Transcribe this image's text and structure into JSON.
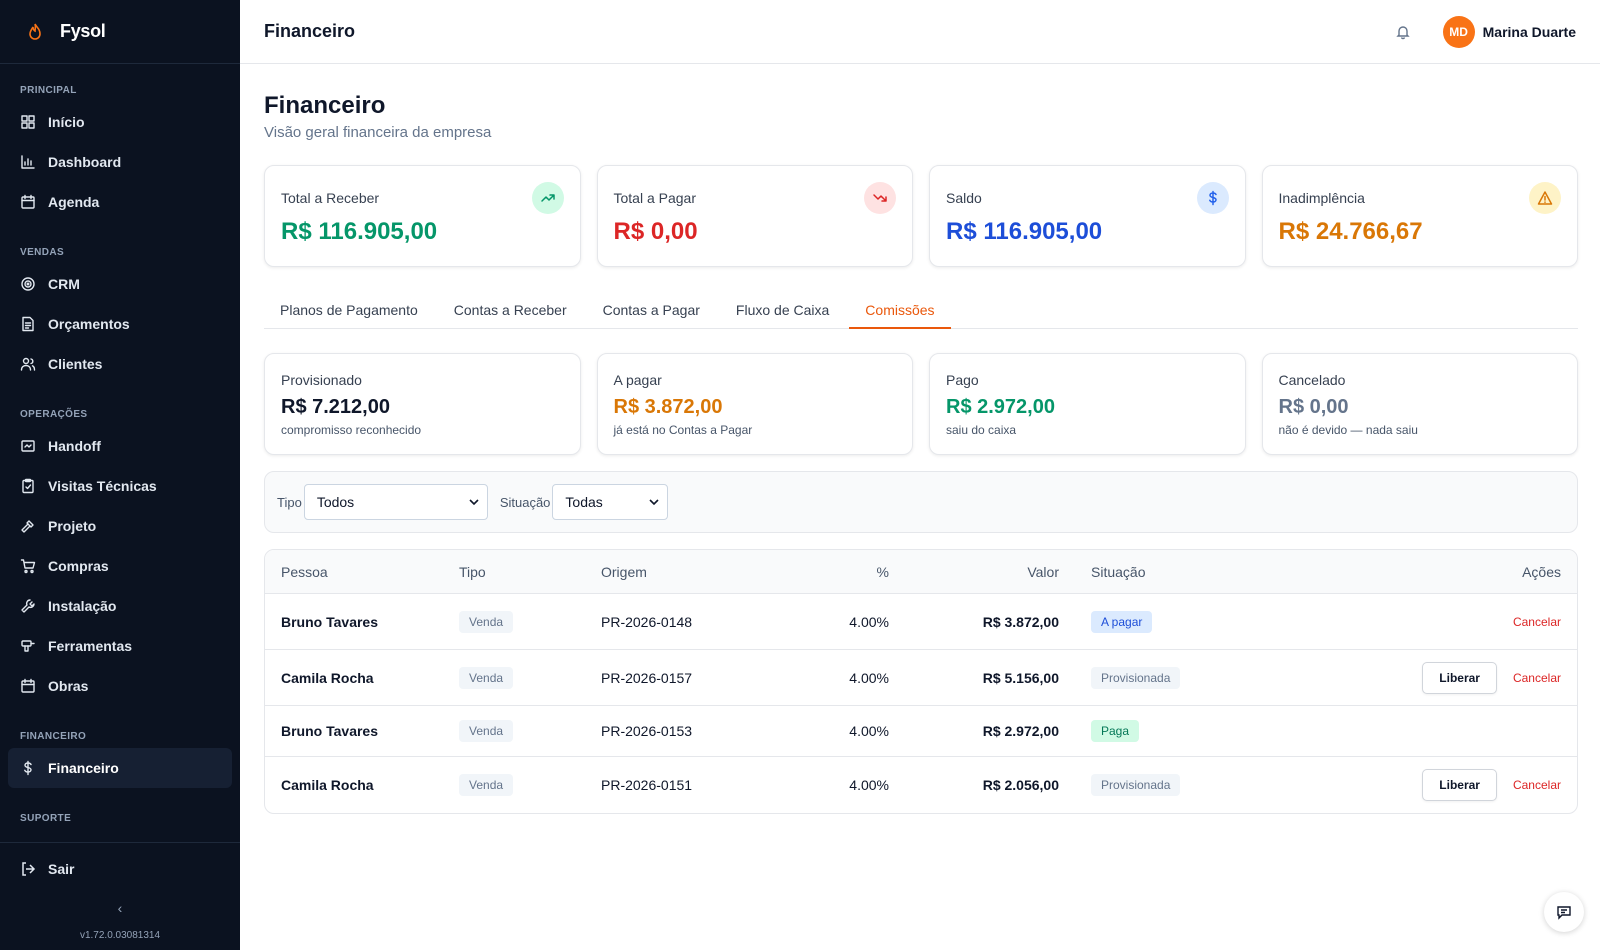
{
  "brand": {
    "name": "Fysol",
    "accent": "#f97316"
  },
  "sidebar": {
    "sections": [
      {
        "label": "PRINCIPAL",
        "items": [
          {
            "label": "Início",
            "icon": "grid-icon"
          },
          {
            "label": "Dashboard",
            "icon": "bar-chart-icon"
          },
          {
            "label": "Agenda",
            "icon": "calendar-icon"
          }
        ]
      },
      {
        "label": "VENDAS",
        "items": [
          {
            "label": "CRM",
            "icon": "target-icon"
          },
          {
            "label": "Orçamentos",
            "icon": "file-text-icon"
          },
          {
            "label": "Clientes",
            "icon": "users-icon"
          }
        ]
      },
      {
        "label": "OPERAÇÕES",
        "items": [
          {
            "label": "Handoff",
            "icon": "handoff-icon"
          },
          {
            "label": "Visitas Técnicas",
            "icon": "clipboard-icon"
          },
          {
            "label": "Projeto",
            "icon": "hammer-icon"
          },
          {
            "label": "Compras",
            "icon": "cart-icon"
          },
          {
            "label": "Instalação",
            "icon": "wrench-icon"
          },
          {
            "label": "Ferramentas",
            "icon": "drill-icon"
          },
          {
            "label": "Obras",
            "icon": "calendar-icon"
          }
        ]
      },
      {
        "label": "FINANCEIRO",
        "items": [
          {
            "label": "Financeiro",
            "icon": "dollar-icon",
            "active": true
          }
        ]
      },
      {
        "label": "SUPORTE",
        "items": []
      }
    ],
    "logout": "Sair",
    "collapse": "‹",
    "version": "v1.72.0.03081314"
  },
  "topbar": {
    "title": "Financeiro",
    "user": {
      "initials": "MD",
      "name": "Marina Duarte"
    }
  },
  "page": {
    "title": "Financeiro",
    "subtitle": "Visão geral financeira da empresa"
  },
  "summary": [
    {
      "label": "Total a Receber",
      "value": "R$ 116.905,00",
      "color": "#059669",
      "icon": "trending-up-icon",
      "icon_bg": "#d1fae5",
      "icon_color": "#059669"
    },
    {
      "label": "Total a Pagar",
      "value": "R$ 0,00",
      "color": "#dc2626",
      "icon": "trending-down-icon",
      "icon_bg": "#fee2e2",
      "icon_color": "#dc2626"
    },
    {
      "label": "Saldo",
      "value": "R$ 116.905,00",
      "color": "#1d4ed8",
      "icon": "dollar-icon",
      "icon_bg": "#dbeafe",
      "icon_color": "#2563eb"
    },
    {
      "label": "Inadimplência",
      "value": "R$ 24.766,67",
      "color": "#d97706",
      "icon": "alert-triangle-icon",
      "icon_bg": "#fef3c7",
      "icon_color": "#d97706"
    }
  ],
  "tabs": [
    {
      "label": "Planos de Pagamento"
    },
    {
      "label": "Contas a Receber"
    },
    {
      "label": "Contas a Pagar"
    },
    {
      "label": "Fluxo de Caixa"
    },
    {
      "label": "Comissões",
      "active": true
    }
  ],
  "commission_summary": [
    {
      "label": "Provisionado",
      "value": "R$ 7.212,00",
      "note": "compromisso reconhecido",
      "color": "#0f172a"
    },
    {
      "label": "A pagar",
      "value": "R$ 3.872,00",
      "note": "já está no Contas a Pagar",
      "color": "#d97706"
    },
    {
      "label": "Pago",
      "value": "R$ 2.972,00",
      "note": "saiu do caixa",
      "color": "#059669"
    },
    {
      "label": "Cancelado",
      "value": "R$ 0,00",
      "note": "não é devido — nada saiu",
      "color": "#64748b"
    }
  ],
  "filters": {
    "tipo": {
      "label": "Tipo",
      "value": "Todos"
    },
    "situacao": {
      "label": "Situação",
      "value": "Todas"
    }
  },
  "table": {
    "headers": [
      "Pessoa",
      "Tipo",
      "Origem",
      "%",
      "Valor",
      "Situação",
      "Ações"
    ],
    "rows": [
      {
        "pessoa": "Bruno Tavares",
        "tipo": "Venda",
        "origem": "PR-2026-0148",
        "pct": "4.00%",
        "valor": "R$ 3.872,00",
        "situacao": "A pagar",
        "sit_bg": "#dbeafe",
        "sit_color": "#1d4ed8",
        "liberar": "",
        "cancelar": "Cancelar"
      },
      {
        "pessoa": "Camila Rocha",
        "tipo": "Venda",
        "origem": "PR-2026-0157",
        "pct": "4.00%",
        "valor": "R$ 5.156,00",
        "situacao": "Provisionada",
        "sit_bg": "#f1f5f9",
        "sit_color": "#64748b",
        "liberar": "Liberar",
        "cancelar": "Cancelar"
      },
      {
        "pessoa": "Bruno Tavares",
        "tipo": "Venda",
        "origem": "PR-2026-0153",
        "pct": "4.00%",
        "valor": "R$ 2.972,00",
        "situacao": "Paga",
        "sit_bg": "#d1fae5",
        "sit_color": "#047857",
        "liberar": "",
        "cancelar": ""
      },
      {
        "pessoa": "Camila Rocha",
        "tipo": "Venda",
        "origem": "PR-2026-0151",
        "pct": "4.00%",
        "valor": "R$ 2.056,00",
        "situacao": "Provisionada",
        "sit_bg": "#f1f5f9",
        "sit_color": "#64748b",
        "liberar": "Liberar",
        "cancelar": "Cancelar"
      }
    ]
  }
}
